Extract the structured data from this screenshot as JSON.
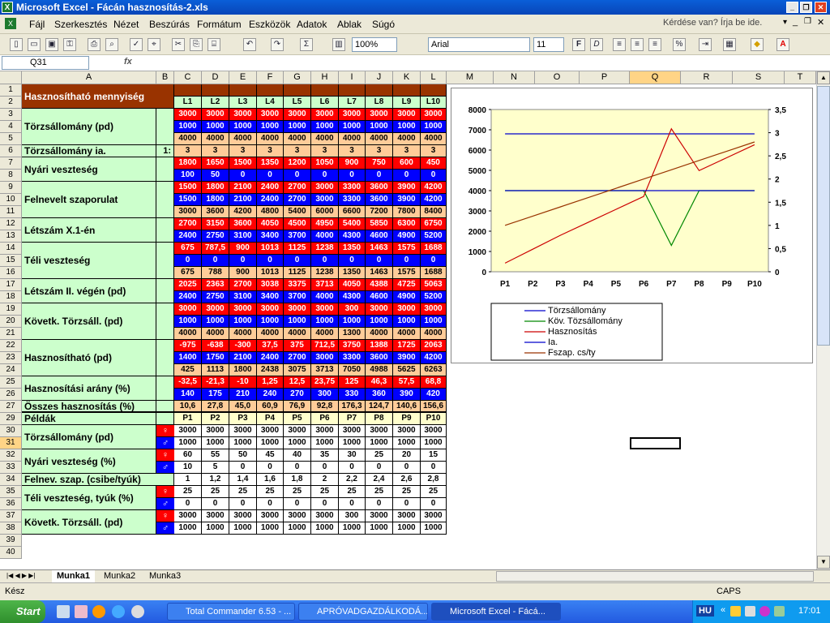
{
  "window": {
    "title": "Microsoft Excel - Fácán hasznosítás-2.xls",
    "help_placeholder": "Kérdése van? Írja be ide."
  },
  "menu": [
    "Fájl",
    "Szerkesztés",
    "Nézet",
    "Beszúrás",
    "Formátum",
    "Eszközök",
    "Adatok",
    "Ablak",
    "Súgó"
  ],
  "toolbar": {
    "zoom": "100%",
    "font": "Arial",
    "size": "11"
  },
  "namebox": "Q31",
  "fx": "fx",
  "columns": [
    "A",
    "B",
    "C",
    "D",
    "E",
    "F",
    "G",
    "H",
    "I",
    "J",
    "K",
    "L",
    "M",
    "N",
    "O",
    "P",
    "Q",
    "R",
    "S",
    "T"
  ],
  "rows": [
    "1",
    "2",
    "3",
    "4",
    "5",
    "6",
    "7",
    "8",
    "9",
    "10",
    "11",
    "12",
    "13",
    "14",
    "15",
    "16",
    "17",
    "18",
    "19",
    "20",
    "21",
    "22",
    "23",
    "24",
    "25",
    "26",
    "27",
    "29",
    "30",
    "31",
    "32",
    "33",
    "34",
    "35",
    "36",
    "37",
    "38",
    "39",
    "40"
  ],
  "header": {
    "title": "Hasznosítható mennyiség",
    "lcols": [
      "L1",
      "L2",
      "L3",
      "L4",
      "L5",
      "L6",
      "L7",
      "L8",
      "L9",
      "L10"
    ]
  },
  "groups": [
    {
      "label": "Törzsállomány (pd)",
      "rows": [
        {
          "c": "red",
          "v": [
            "3000",
            "3000",
            "3000",
            "3000",
            "3000",
            "3000",
            "3000",
            "3000",
            "3000",
            "3000"
          ]
        },
        {
          "c": "blue",
          "v": [
            "1000",
            "1000",
            "1000",
            "1000",
            "1000",
            "1000",
            "1000",
            "1000",
            "1000",
            "1000"
          ]
        },
        {
          "c": "tan",
          "v": [
            "4000",
            "4000",
            "4000",
            "4000",
            "4000",
            "4000",
            "4000",
            "4000",
            "4000",
            "4000"
          ]
        }
      ]
    },
    {
      "label": "Törzsállomány ia.",
      "b": "1:",
      "rows": [
        {
          "c": "tan",
          "v": [
            "3",
            "3",
            "3",
            "3",
            "3",
            "3",
            "3",
            "3",
            "3",
            "3"
          ]
        }
      ]
    },
    {
      "label": "Nyári veszteség",
      "rows": [
        {
          "c": "red",
          "v": [
            "1800",
            "1650",
            "1500",
            "1350",
            "1200",
            "1050",
            "900",
            "750",
            "600",
            "450"
          ]
        },
        {
          "c": "blue",
          "v": [
            "100",
            "50",
            "0",
            "0",
            "0",
            "0",
            "0",
            "0",
            "0",
            "0"
          ]
        }
      ]
    },
    {
      "label": "Felnevelt szaporulat",
      "rows": [
        {
          "c": "red",
          "v": [
            "1500",
            "1800",
            "2100",
            "2400",
            "2700",
            "3000",
            "3300",
            "3600",
            "3900",
            "4200"
          ]
        },
        {
          "c": "blue",
          "v": [
            "1500",
            "1800",
            "2100",
            "2400",
            "2700",
            "3000",
            "3300",
            "3600",
            "3900",
            "4200"
          ]
        },
        {
          "c": "tan",
          "v": [
            "3000",
            "3600",
            "4200",
            "4800",
            "5400",
            "6000",
            "6600",
            "7200",
            "7800",
            "8400"
          ]
        }
      ]
    },
    {
      "label": "Létszám X.1-én",
      "rows": [
        {
          "c": "red",
          "v": [
            "2700",
            "3150",
            "3600",
            "4050",
            "4500",
            "4950",
            "5400",
            "5850",
            "6300",
            "6750"
          ]
        },
        {
          "c": "blue",
          "v": [
            "2400",
            "2750",
            "3100",
            "3400",
            "3700",
            "4000",
            "4300",
            "4600",
            "4900",
            "5200"
          ]
        }
      ]
    },
    {
      "label": "Téli veszteség",
      "rows": [
        {
          "c": "red",
          "v": [
            "675",
            "787,5",
            "900",
            "1013",
            "1125",
            "1238",
            "1350",
            "1463",
            "1575",
            "1688"
          ]
        },
        {
          "c": "blue",
          "v": [
            "0",
            "0",
            "0",
            "0",
            "0",
            "0",
            "0",
            "0",
            "0",
            "0"
          ]
        },
        {
          "c": "tan",
          "v": [
            "675",
            "788",
            "900",
            "1013",
            "1125",
            "1238",
            "1350",
            "1463",
            "1575",
            "1688"
          ]
        }
      ]
    },
    {
      "label": "Létszám II. végén (pd)",
      "rows": [
        {
          "c": "red",
          "v": [
            "2025",
            "2363",
            "2700",
            "3038",
            "3375",
            "3713",
            "4050",
            "4388",
            "4725",
            "5063"
          ]
        },
        {
          "c": "blue",
          "v": [
            "2400",
            "2750",
            "3100",
            "3400",
            "3700",
            "4000",
            "4300",
            "4600",
            "4900",
            "5200"
          ]
        }
      ]
    },
    {
      "label": "Követk. Törzsáll. (pd)",
      "rows": [
        {
          "c": "red",
          "v": [
            "3000",
            "3000",
            "3000",
            "3000",
            "3000",
            "3000",
            "300",
            "3000",
            "3000",
            "3000"
          ]
        },
        {
          "c": "blue",
          "v": [
            "1000",
            "1000",
            "1000",
            "1000",
            "1000",
            "1000",
            "1000",
            "1000",
            "1000",
            "1000"
          ]
        },
        {
          "c": "tan",
          "v": [
            "4000",
            "4000",
            "4000",
            "4000",
            "4000",
            "4000",
            "1300",
            "4000",
            "4000",
            "4000"
          ]
        }
      ]
    },
    {
      "label": "Hasznosítható (pd)",
      "rows": [
        {
          "c": "red",
          "v": [
            "-975",
            "-638",
            "-300",
            "37,5",
            "375",
            "712,5",
            "3750",
            "1388",
            "1725",
            "2063"
          ]
        },
        {
          "c": "blue",
          "v": [
            "1400",
            "1750",
            "2100",
            "2400",
            "2700",
            "3000",
            "3300",
            "3600",
            "3900",
            "4200"
          ]
        },
        {
          "c": "tan",
          "v": [
            "425",
            "1113",
            "1800",
            "2438",
            "3075",
            "3713",
            "7050",
            "4988",
            "5625",
            "6263"
          ]
        }
      ]
    },
    {
      "label": "Hasznosítási arány (%)",
      "rows": [
        {
          "c": "red",
          "v": [
            "-32,5",
            "-21,3",
            "-10",
            "1,25",
            "12,5",
            "23,75",
            "125",
            "46,3",
            "57,5",
            "68,8"
          ]
        },
        {
          "c": "blue",
          "v": [
            "140",
            "175",
            "210",
            "240",
            "270",
            "300",
            "330",
            "360",
            "390",
            "420"
          ]
        }
      ]
    },
    {
      "label": "Összes hasznosítás (%)",
      "rows": [
        {
          "c": "tan",
          "v": [
            "10,6",
            "27,8",
            "45,0",
            "60,9",
            "76,9",
            "92,8",
            "176,3",
            "124,7",
            "140,6",
            "156,6"
          ]
        }
      ]
    }
  ],
  "examples": {
    "title": "Példák",
    "pcols": [
      "P1",
      "P2",
      "P3",
      "P4",
      "P5",
      "P6",
      "P7",
      "P8",
      "P9",
      "P10"
    ],
    "female": "♀",
    "male": "♂",
    "groups": [
      {
        "label": "Törzsállomány (pd)",
        "rows": [
          {
            "s": "f",
            "v": [
              "3000",
              "3000",
              "3000",
              "3000",
              "3000",
              "3000",
              "3000",
              "3000",
              "3000",
              "3000"
            ]
          },
          {
            "s": "m",
            "v": [
              "1000",
              "1000",
              "1000",
              "1000",
              "1000",
              "1000",
              "1000",
              "1000",
              "1000",
              "1000"
            ]
          }
        ]
      },
      {
        "label": "Nyári veszteség (%)",
        "rows": [
          {
            "s": "f",
            "v": [
              "60",
              "55",
              "50",
              "45",
              "40",
              "35",
              "30",
              "25",
              "20",
              "15"
            ]
          },
          {
            "s": "m",
            "v": [
              "10",
              "5",
              "0",
              "0",
              "0",
              "0",
              "0",
              "0",
              "0",
              "0"
            ]
          }
        ]
      },
      {
        "label": "Felnev. szap. (csibe/tyúk)",
        "rows": [
          {
            "s": "",
            "v": [
              "1",
              "1,2",
              "1,4",
              "1,6",
              "1,8",
              "2",
              "2,2",
              "2,4",
              "2,6",
              "2,8"
            ]
          }
        ]
      },
      {
        "label": "Téli veszteség, tyúk (%)",
        "rows": [
          {
            "s": "f",
            "v": [
              "25",
              "25",
              "25",
              "25",
              "25",
              "25",
              "25",
              "25",
              "25",
              "25"
            ]
          },
          {
            "s": "m",
            "v": [
              "0",
              "0",
              "0",
              "0",
              "0",
              "0",
              "0",
              "0",
              "0",
              "0"
            ]
          }
        ]
      },
      {
        "label": "Követk. Törzsáll. (pd)",
        "rows": [
          {
            "s": "f",
            "v": [
              "3000",
              "3000",
              "3000",
              "3000",
              "3000",
              "3000",
              "300",
              "3000",
              "3000",
              "3000"
            ]
          },
          {
            "s": "m",
            "v": [
              "1000",
              "1000",
              "1000",
              "1000",
              "1000",
              "1000",
              "1000",
              "1000",
              "1000",
              "1000"
            ]
          }
        ]
      }
    ]
  },
  "chart_data": {
    "type": "line",
    "categories": [
      "P1",
      "P2",
      "P3",
      "P4",
      "P5",
      "P6",
      "P7",
      "P8",
      "P9",
      "P10"
    ],
    "ylim": [
      0,
      8000
    ],
    "y2lim": [
      0,
      3.5
    ],
    "yticks": [
      "8000",
      "7000",
      "6000",
      "5000",
      "4000",
      "3000",
      "2000",
      "1000",
      "0"
    ],
    "y2ticks": [
      "3,5",
      "3",
      "2,5",
      "2",
      "1,5",
      "1",
      "0,5",
      "0"
    ],
    "series": [
      {
        "name": "Törzsállomány",
        "color": "#0000cc",
        "axis": "y",
        "values": [
          6800,
          6800,
          6800,
          6800,
          6800,
          6800,
          6800,
          6800,
          6800,
          6800
        ]
      },
      {
        "name": "Köv. Tözsállomány",
        "color": "#008800",
        "axis": "y",
        "values": [
          4000,
          4000,
          4000,
          4000,
          4000,
          4000,
          1300,
          4000,
          4000,
          4000
        ]
      },
      {
        "name": "Hasznosítás",
        "color": "#cc0000",
        "axis": "y",
        "values": [
          425,
          1113,
          1800,
          2438,
          3075,
          3713,
          7050,
          4988,
          5625,
          6263
        ]
      },
      {
        "name": "Ia.",
        "color": "#0000cc",
        "axis": "y2",
        "values": [
          1.75,
          1.75,
          1.75,
          1.75,
          1.75,
          1.75,
          1.75,
          1.75,
          1.75,
          1.75
        ]
      },
      {
        "name": "Fszap. cs/ty",
        "color": "#993300",
        "axis": "y2",
        "values": [
          1,
          1.2,
          1.4,
          1.6,
          1.8,
          2,
          2.2,
          2.4,
          2.6,
          2.8
        ]
      }
    ]
  },
  "sheets": [
    "Munka1",
    "Munka2",
    "Munka3"
  ],
  "status": {
    "left": "Kész",
    "caps": "CAPS"
  },
  "taskbar": {
    "start": "Start",
    "tasks": [
      "Total Commander 6.53 - ...",
      "APRÓVADGAZDÁLKODÁ...",
      "Microsoft Excel - Fácá..."
    ],
    "lang": "HU",
    "clock": "17:01"
  }
}
